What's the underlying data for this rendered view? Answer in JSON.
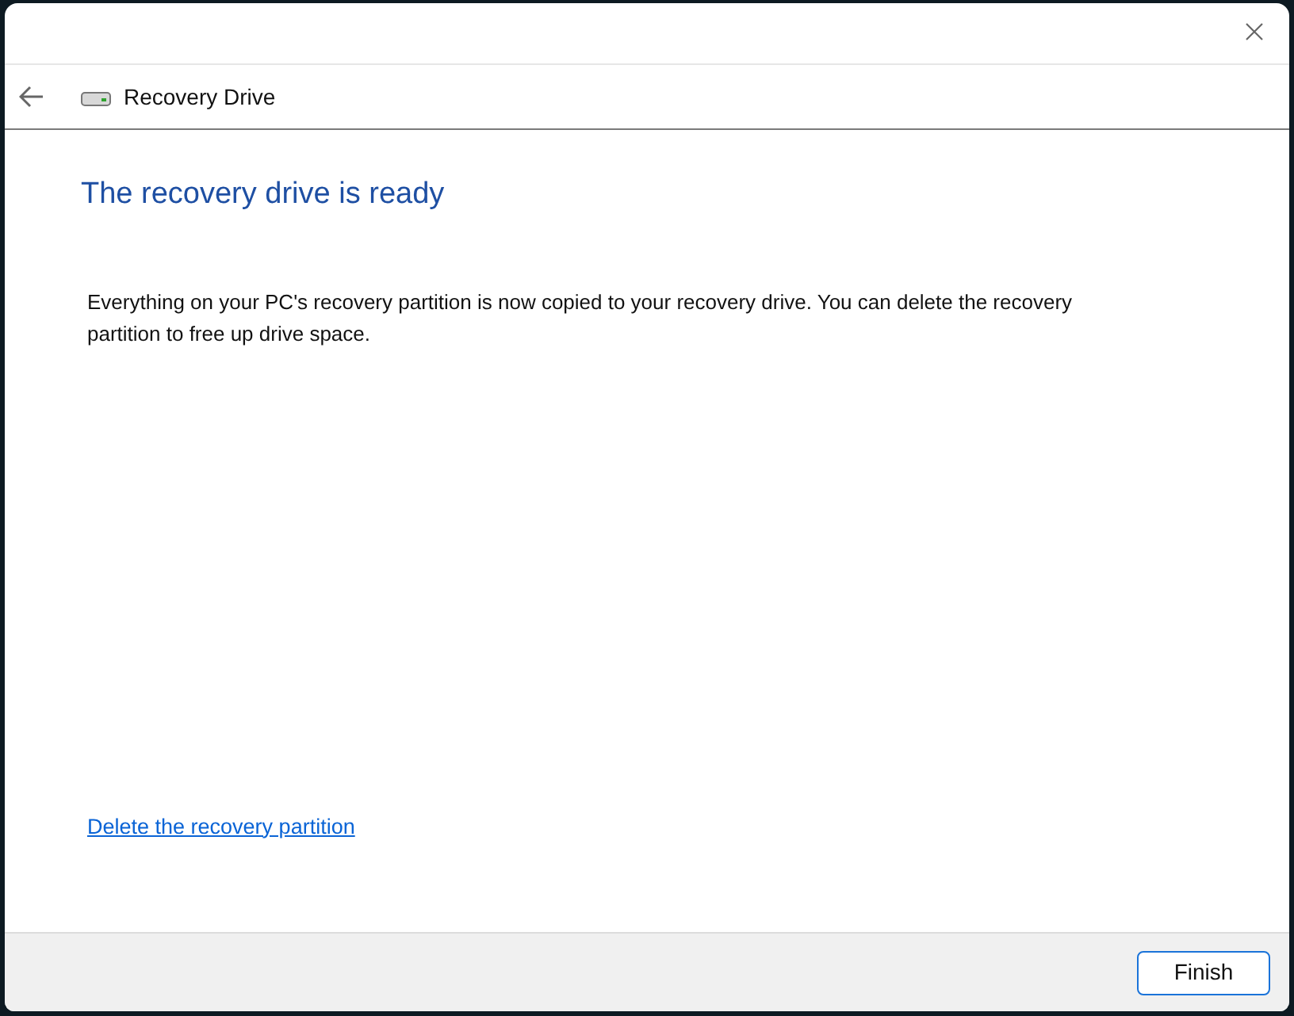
{
  "window": {
    "title": "Recovery Drive"
  },
  "heading": "The recovery drive is ready",
  "message": "Everything on your PC's recovery partition is now copied to your recovery drive. You can delete the recovery partition to free up drive space.",
  "link": "Delete the recovery partition",
  "buttons": [
    {
      "label": "Finish",
      "default": true
    }
  ]
}
